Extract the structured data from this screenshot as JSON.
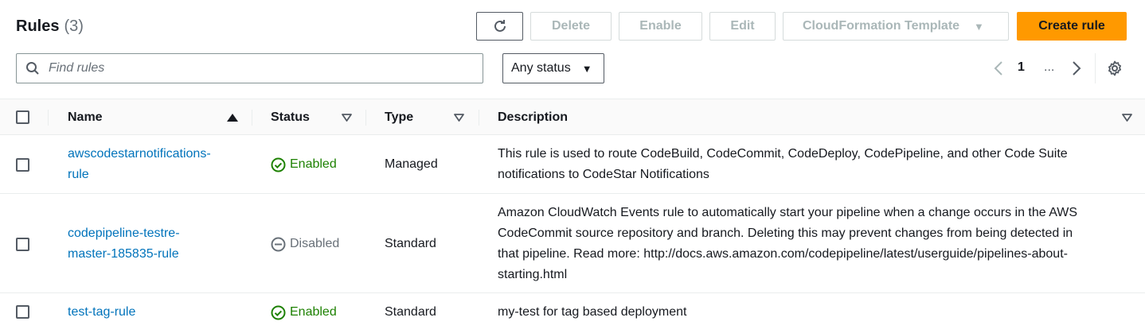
{
  "header": {
    "title": "Rules",
    "count": "(3)",
    "buttons": {
      "delete": "Delete",
      "enable": "Enable",
      "edit": "Edit",
      "cloudformation": "CloudFormation Template",
      "create": "Create rule"
    }
  },
  "search": {
    "placeholder": "Find rules",
    "value": ""
  },
  "status_filter": {
    "selected": "Any status"
  },
  "pagination": {
    "current": "1",
    "ellipsis": "..."
  },
  "table": {
    "columns": {
      "name": "Name",
      "status": "Status",
      "type": "Type",
      "description": "Description"
    },
    "rows": [
      {
        "name_lines": [
          "awscodestarnotifications-",
          "rule"
        ],
        "status": "Enabled",
        "type": "Managed",
        "description_lines": [
          "This rule is used to route CodeBuild, CodeCommit, CodeDeploy, CodePipeline, and other Code Suite",
          "notifications to CodeStar Notifications"
        ]
      },
      {
        "name_lines": [
          "codepipeline-testre-",
          "master-185835-rule"
        ],
        "status": "Disabled",
        "type": "Standard",
        "description_lines": [
          "Amazon CloudWatch Events rule to automatically start your pipeline when a change occurs in the AWS",
          "CodeCommit source repository and branch. Deleting this may prevent changes from being detected in",
          "that pipeline. Read more: http://docs.aws.amazon.com/codepipeline/latest/userguide/pipelines-about-",
          "starting.html"
        ]
      },
      {
        "name_lines": [
          "test-tag-rule"
        ],
        "status": "Enabled",
        "type": "Standard",
        "description_lines": [
          "my-test for tag based deployment"
        ]
      }
    ]
  },
  "colors": {
    "accent": "#ff9900",
    "link": "#0073bb",
    "enabled": "#1d8102",
    "disabled": "#687078"
  }
}
